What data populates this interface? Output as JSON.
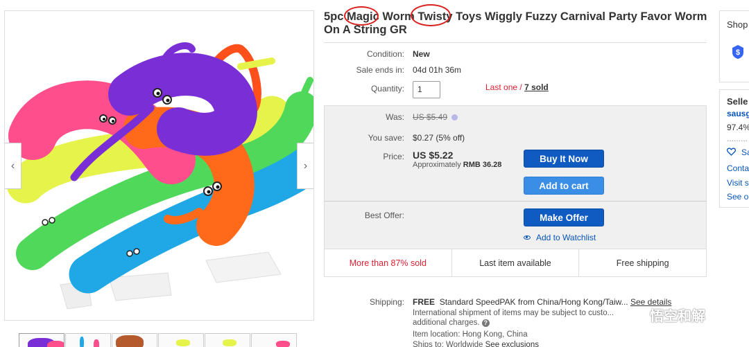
{
  "title": "5pc Magic Worm Twisty Toys Wiggly Fuzzy Carnival Party Favor Worm On A String GR",
  "gallery": {
    "prev_icon": "chevron-left-icon",
    "next_icon": "chevron-right-icon",
    "thumbnail_count": 6
  },
  "details": {
    "condition_label": "Condition:",
    "condition_value": "New",
    "sale_ends_label": "Sale ends in:",
    "sale_ends_value": "04d 01h 36m",
    "quantity_label": "Quantity:",
    "quantity_value": "1",
    "availability": "Last one",
    "availability_sep": " / ",
    "sold": "7 sold"
  },
  "pricing": {
    "was_label": "Was:",
    "was_value": "US $5.49",
    "save_label": "You save:",
    "save_value": "$0.27 (5% off)",
    "price_label": "Price:",
    "price_value": "US $5.22",
    "approx_label": "Approximately",
    "approx_value": "RMB 36.28",
    "buy_now": "Buy It Now",
    "add_to_cart": "Add to cart",
    "best_offer_label": "Best Offer:",
    "make_offer": "Make Offer",
    "watchlist": "Add to Watchlist"
  },
  "highlights": [
    "More than 87% sold",
    "Last item available",
    "Free shipping"
  ],
  "shipping": {
    "label": "Shipping:",
    "free": "FREE",
    "service": "Standard SpeedPAK from China/Hong Kong/Taiw...",
    "see_details": "See details",
    "intl_line1": "International shipment of items may be subject to custo...",
    "intl_line2": "additional charges.",
    "location_label": "Item location:",
    "location": "Hong Kong, China",
    "ships_to": "Ships to: Worldwide",
    "exclusions": "See exclusions"
  },
  "side": {
    "shop_label": "Shop",
    "seller_label": "Selle",
    "seller_name": "sausg",
    "feedback": "97.4%",
    "save_seller": "Sa",
    "contact": "Conta",
    "visit": "Visit s",
    "see_other": "See o"
  },
  "watermark": "悟空和解",
  "colors": {
    "accent_blue": "#0f5bc2",
    "cart_blue": "#3a8ee6",
    "alert_red": "#dd1e31",
    "annotation_red": "#d9201d"
  }
}
